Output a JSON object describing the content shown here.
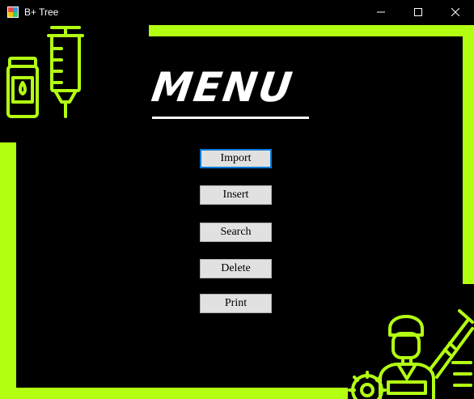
{
  "window": {
    "title": "B+ Tree",
    "minimize_icon": "minimize-icon",
    "maximize_icon": "maximize-icon",
    "close_icon": "close-icon"
  },
  "menu": {
    "title": "MENU",
    "buttons": [
      {
        "label": "Import",
        "focused": true
      },
      {
        "label": "Insert",
        "focused": false
      },
      {
        "label": "Search",
        "focused": false
      },
      {
        "label": "Delete",
        "focused": false
      },
      {
        "label": "Print",
        "focused": false
      }
    ]
  },
  "colors": {
    "accent": "#b3ff12",
    "background": "#000000",
    "button_face": "#e1e1e1",
    "focus_border": "#0078d7"
  },
  "decorations": {
    "top_left": "medicine-bottle-and-syringe-icon",
    "bottom_right": "doctor-with-syringe-and-gear-icon"
  }
}
